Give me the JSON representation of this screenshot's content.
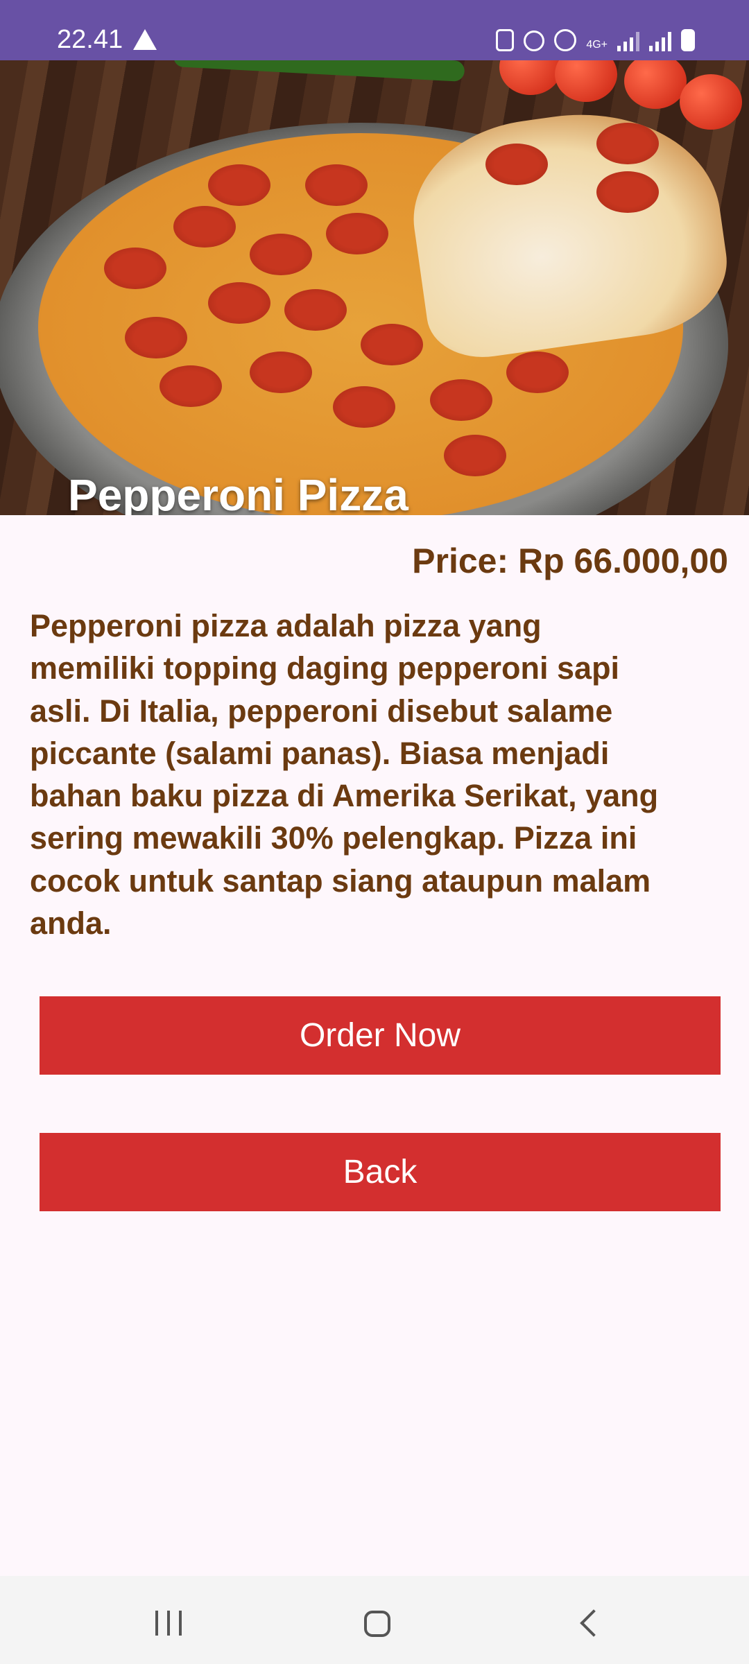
{
  "status_bar": {
    "time": "22.41",
    "icons": [
      "warning-icon",
      "battery-saver-icon",
      "alarm-icon",
      "hotspot-icon",
      "4g-plus-icon",
      "signal-icon",
      "signal-icon",
      "battery-charging-icon"
    ],
    "network_label": "4G+",
    "color": "#6851a5"
  },
  "product": {
    "name": "Pepperoni Pizza",
    "price": "Price: Rp 66.000,00",
    "description_lines": [
      "Pepperoni pizza adalah pizza yang",
      "memiliki topping daging pepperoni sapi",
      "asli. Di Italia, pepperoni disebut salame",
      "piccante (salami panas). Biasa menjadi",
      "bahan baku pizza di Amerika Serikat, yang",
      "sering mewakili 30% pelengkap. Pizza ini",
      "cocok untuk santap siang ataupun malam",
      "anda."
    ]
  },
  "buttons": {
    "order": "Order Now",
    "back": "Back",
    "color": "#d32f2f"
  },
  "text_color": "#6b3a10"
}
